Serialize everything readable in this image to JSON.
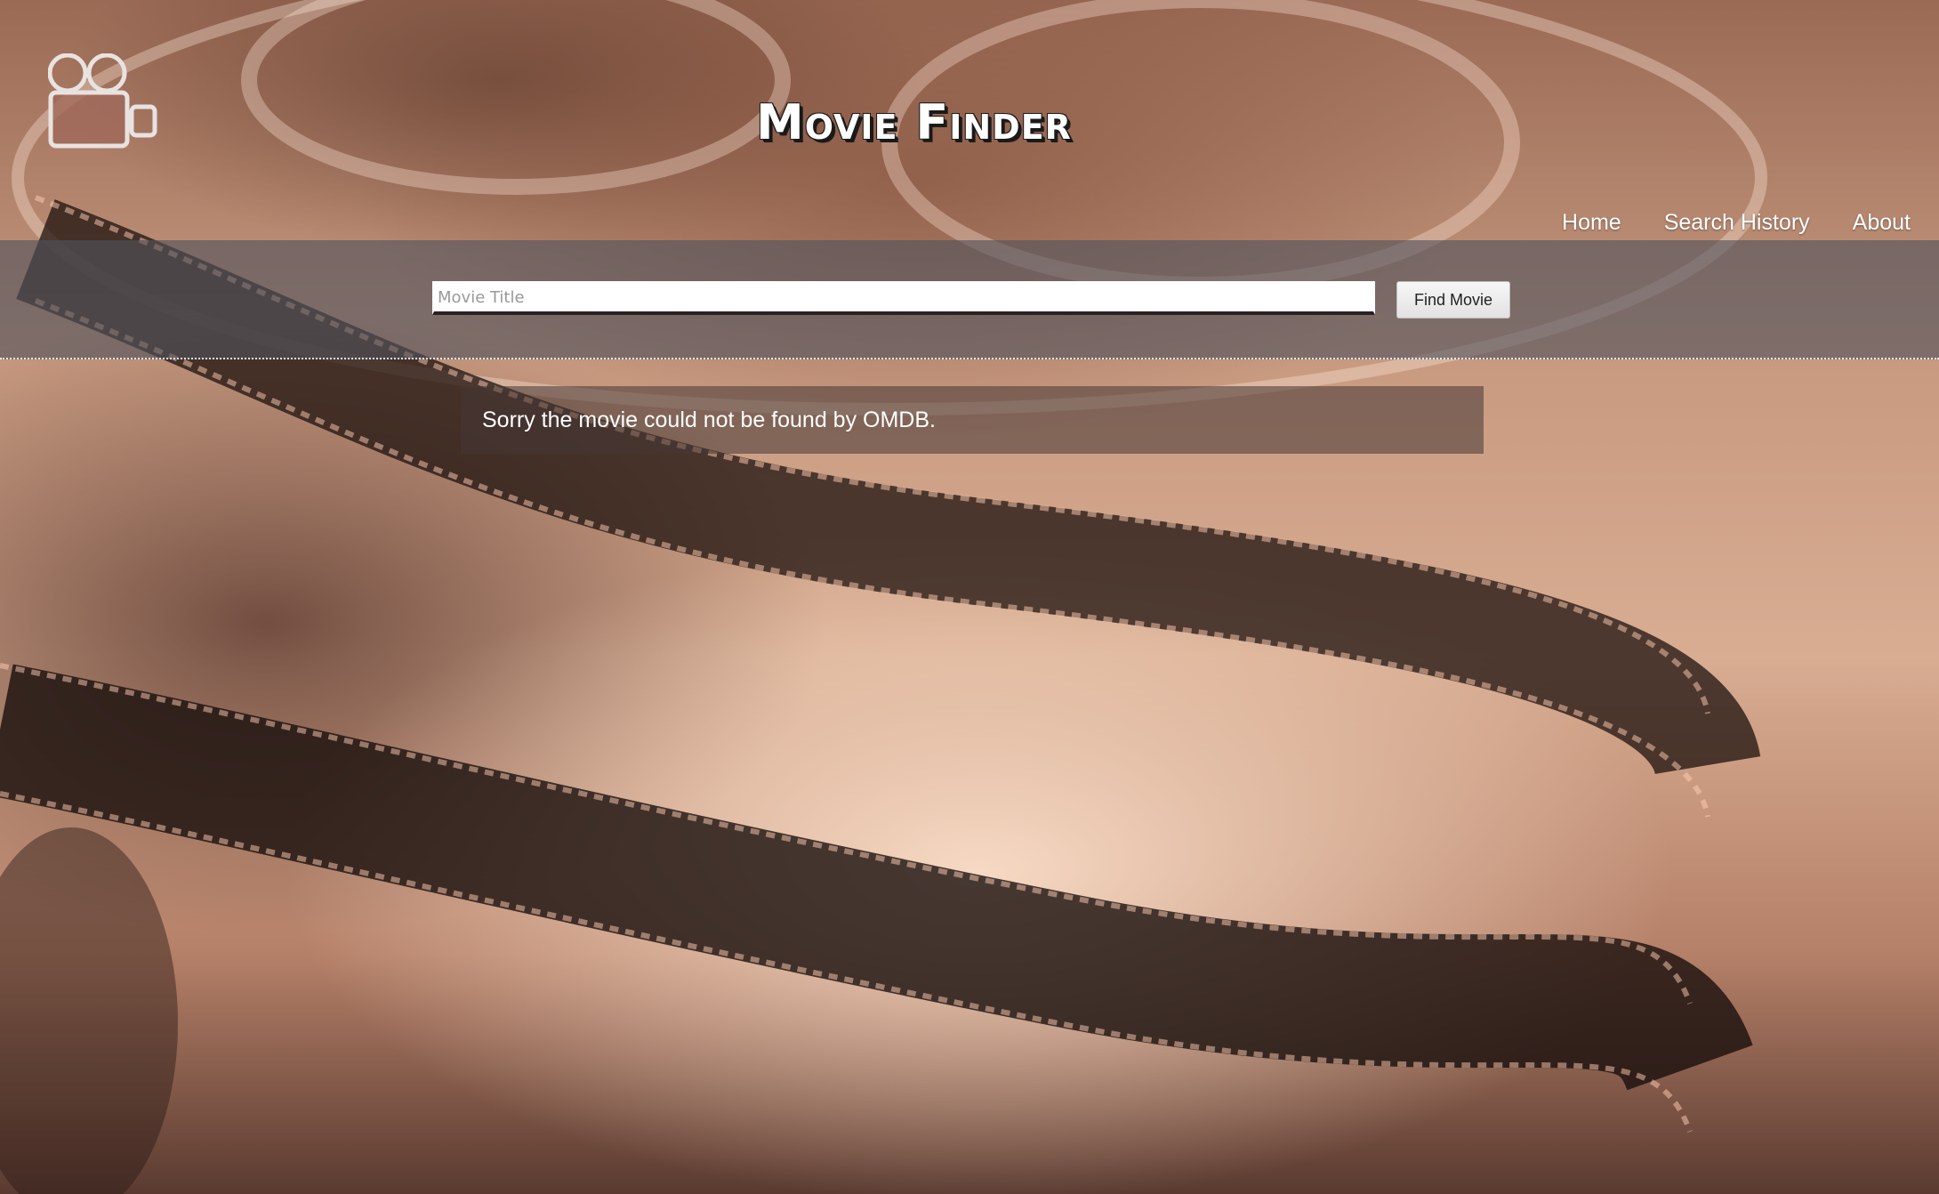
{
  "header": {
    "title": "Movie Finder",
    "logo_icon": "video-camera-icon"
  },
  "nav": {
    "items": [
      {
        "label": "Home"
      },
      {
        "label": "Search History"
      },
      {
        "label": "About"
      }
    ]
  },
  "search": {
    "placeholder": "Movie Title",
    "value": "",
    "button_label": "Find Movie"
  },
  "result": {
    "message": "Sorry the movie could not be found by OMDB."
  }
}
